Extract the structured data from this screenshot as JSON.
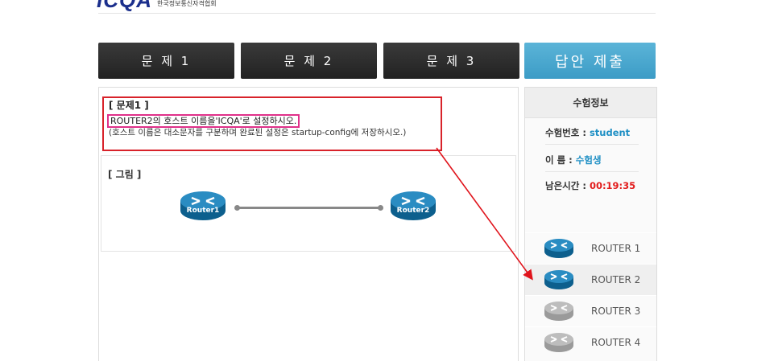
{
  "header": {
    "logo_text": "ICQA",
    "logo_sub": "한국정보통신자격협회"
  },
  "tabs": [
    {
      "label": "문 제 1"
    },
    {
      "label": "문 제 2"
    },
    {
      "label": "문 제 3"
    }
  ],
  "submit_label": "답안 제출",
  "question": {
    "title": "[ 문제1 ]",
    "line1": "ROUTER2의 호스트 이름을'ICQA'로 설정하시오.",
    "line2": "(호스트 이름은 대소문자를 구분하며 완료된 설정은 startup-config에 저장하시오.)"
  },
  "figure": {
    "label": "[ 그림 ]",
    "router1": "Router1",
    "router2": "Router2"
  },
  "sidebar": {
    "title": "수험정보",
    "exam_no_label": "수험번호 : ",
    "exam_no": "student",
    "name_label": "이 름 : ",
    "name": "수험생",
    "time_label": "남은시간 : ",
    "time": "00:19:35",
    "routers": [
      {
        "label": "ROUTER 1",
        "state": "active"
      },
      {
        "label": "ROUTER 2",
        "state": "active"
      },
      {
        "label": "ROUTER 3",
        "state": "inactive"
      },
      {
        "label": "ROUTER 4",
        "state": "inactive"
      }
    ]
  },
  "colors": {
    "active_router": "#1f7fb0",
    "inactive_router": "#b3b3b3",
    "submit": "#4aa9d2",
    "highlight_pink": "#e0308a",
    "highlight_red": "#d8222a"
  }
}
